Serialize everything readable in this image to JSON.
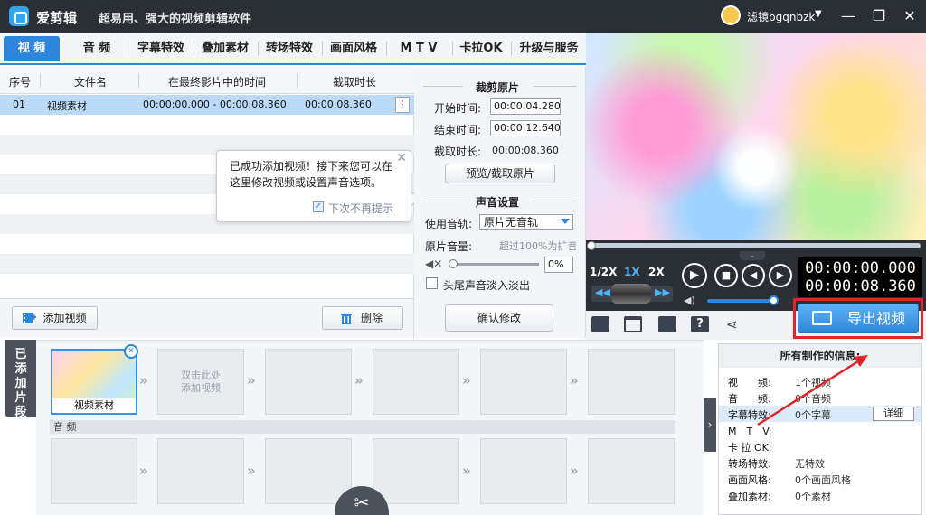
{
  "app": {
    "title": "爱剪辑",
    "slogan": "超易用、强大的视频剪辑软件",
    "user": "滤镜bgqnbzk"
  },
  "window_buttons": {
    "minimize": "—",
    "maximize": "❐",
    "close": "✕"
  },
  "tabs": [
    "视 频",
    "音 频",
    "字幕特效",
    "叠加素材",
    "转场特效",
    "画面风格",
    "M T V",
    "卡拉OK",
    "升级与服务"
  ],
  "table": {
    "headers": [
      "序号",
      "文件名",
      "在最终影片中的时间",
      "截取时长"
    ],
    "rows": [
      {
        "index": "01",
        "name": "视频素材",
        "range": "00:00:00.000 - 00:00:08.360",
        "duration": "00:00:08.360"
      }
    ],
    "row_menu": "⋮"
  },
  "tooltip": {
    "text": "已成功添加视频！接下来您可以在这里修改视频或设置声音选项。",
    "checkbox_label": "下次不再提示",
    "close": "✕"
  },
  "left_buttons": {
    "add": "添加视频",
    "delete": "删除"
  },
  "settings": {
    "crop_title": "裁剪原片",
    "start_label": "开始时间:",
    "start_value": "00:00:04.280",
    "end_label": "结束时间:",
    "end_value": "00:00:12.640",
    "cut_label": "截取时长:",
    "cut_value": "00:00:08.360",
    "preview_button": "预览/截取原片",
    "audio_title": "声音设置",
    "track_label": "使用音轨:",
    "track_value": "原片无音轨",
    "volume_label": "原片音量:",
    "volume_hint": "超过100%为扩音",
    "volume_value": "0%",
    "volume_level": 0,
    "fade_label": "头尾声音淡入淡出",
    "confirm_button": "确认修改"
  },
  "player": {
    "speeds": [
      "1/2X",
      "1X",
      "2X"
    ],
    "active_speed": "1X",
    "current_time": "00:00:00.000",
    "total_time": "00:00:08.360",
    "play_progress": 0,
    "volume_level": 1,
    "buttons": {
      "play": "▶",
      "stop": "■",
      "prev": "◀",
      "next": "▶"
    }
  },
  "export_button": "导出视频",
  "timeline": {
    "side_label": "已添加片段",
    "filled_clip_label": "视频素材",
    "empty_hint": "双击此处添加视频",
    "audio_label": "音 频"
  },
  "info_panel": {
    "title": "所有制作的信息:",
    "rows": [
      {
        "key": "视　　频:",
        "value": "1个视频"
      },
      {
        "key": "音　　频:",
        "value": "0个音频"
      },
      {
        "key": "字幕特效:",
        "value": "0个字幕"
      },
      {
        "key": "M　T　V:",
        "value": ""
      },
      {
        "key": "卡 拉 OK:",
        "value": ""
      },
      {
        "key": "转场特效:",
        "value": "无特效"
      },
      {
        "key": "画面风格:",
        "value": "0个画面风格"
      },
      {
        "key": "叠加素材:",
        "value": "0个素材"
      }
    ],
    "detail_button": "详细"
  },
  "colors": {
    "accent": "#2d86d9",
    "titlebar": "#2a2f36",
    "highlight_border": "#e0262a"
  }
}
